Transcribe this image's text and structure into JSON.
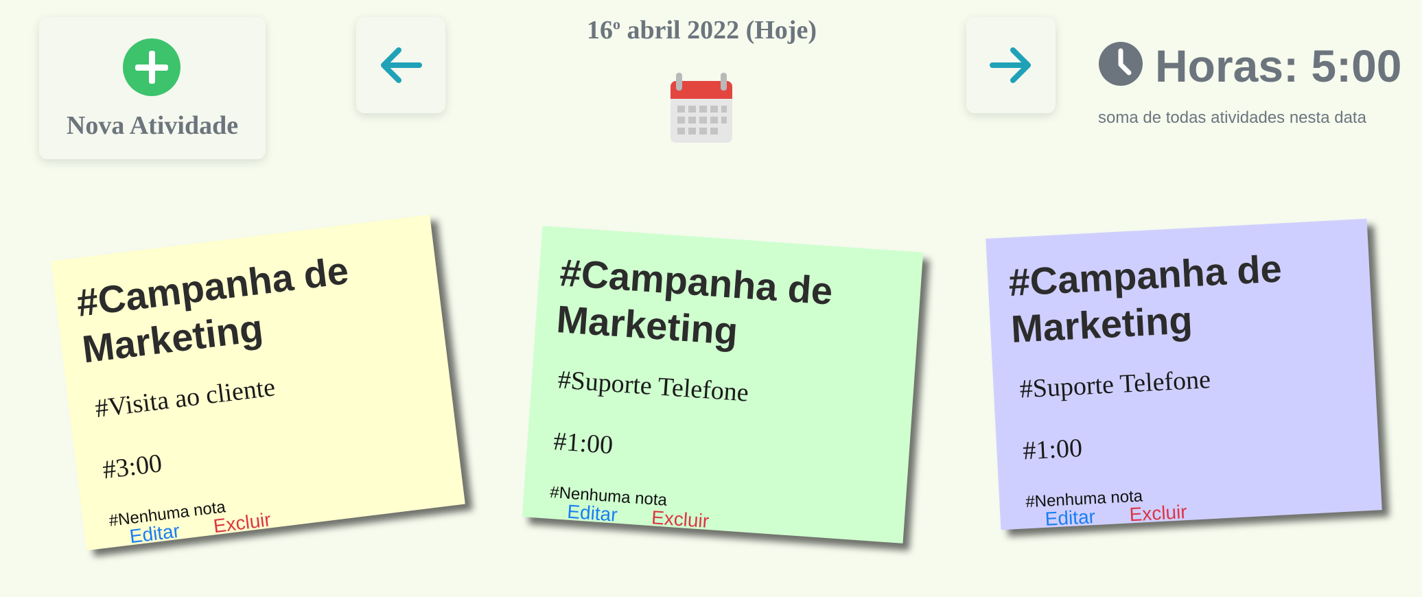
{
  "new_activity": {
    "label": "Nova Atividade",
    "icon": "plus-circle-icon",
    "icon_color": "#3cc36c"
  },
  "navigation": {
    "prev_icon": "arrow-left-icon",
    "next_icon": "arrow-right-icon",
    "arrow_color": "#1fa2b8",
    "date_day": "16",
    "date_ordinal": "o",
    "date_rest": " abril 2022 (Hoje)",
    "calendar_icon": "calendar-icon"
  },
  "hours": {
    "icon": "clock-icon",
    "total": "Horas: 5:00",
    "caption": "soma de todas atividades nesta data"
  },
  "notes": [
    {
      "title": "#Campanha de Marketing",
      "type": "#Visita ao cliente",
      "hours": "#3:00",
      "note": "#Nenhuma nota",
      "edit": "Editar",
      "delete": "Excluir",
      "color": "#ffffcf"
    },
    {
      "title": "#Campanha de Marketing",
      "type": "#Suporte Telefone",
      "hours": "#1:00",
      "note": "#Nenhuma nota",
      "edit": "Editar",
      "delete": "Excluir",
      "color": "#cfffcf"
    },
    {
      "title": "#Campanha de Marketing",
      "type": "#Suporte Telefone",
      "hours": "#1:00",
      "note": "#Nenhuma nota",
      "edit": "Editar",
      "delete": "Excluir",
      "color": "#cfcfff"
    }
  ]
}
